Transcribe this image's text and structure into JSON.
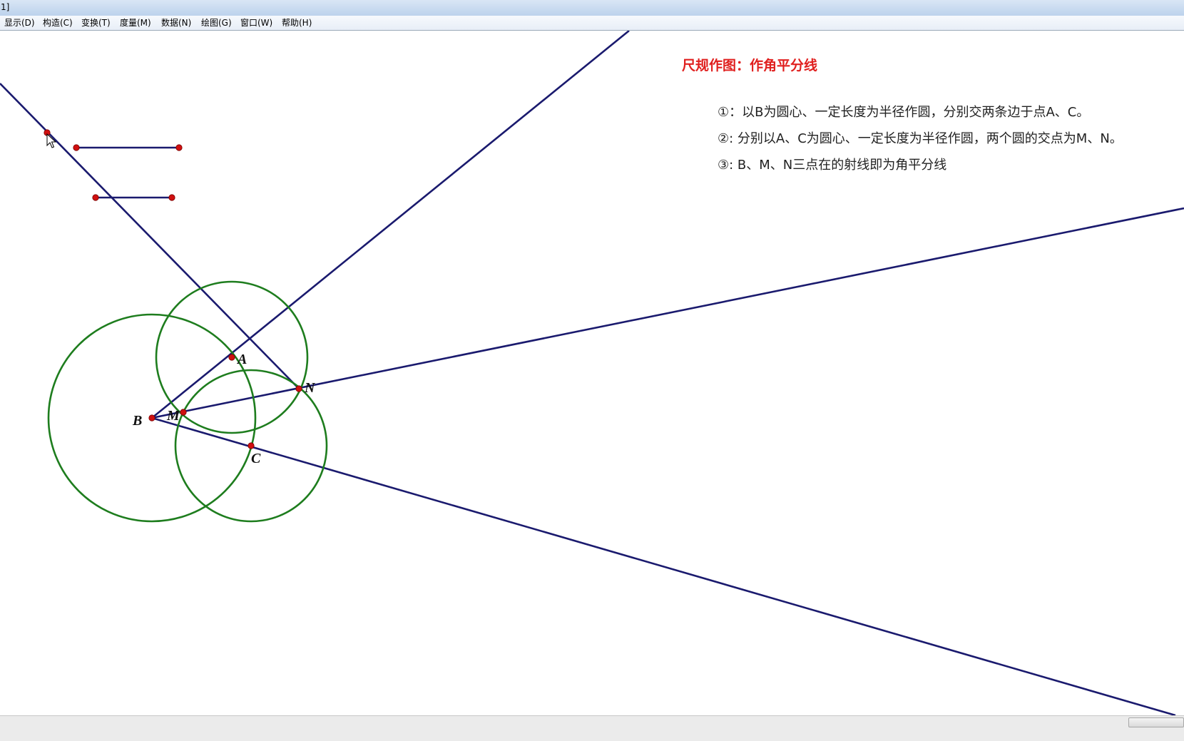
{
  "window": {
    "title": "1]"
  },
  "menubar": {
    "items": [
      {
        "label": "显示(D)"
      },
      {
        "label": "构造(C)"
      },
      {
        "label": "变换(T)"
      },
      {
        "label": "度量(M)"
      },
      {
        "label": "数据(N)"
      },
      {
        "label": "绘图(G)"
      },
      {
        "label": "窗口(W)"
      },
      {
        "label": "帮助(H)"
      }
    ]
  },
  "content": {
    "heading": "尺规作图：作角平分线",
    "steps": [
      "①：以B为圆心、一定长度为半径作圆，分别交两条边于点A、C。",
      "②:  分别以A、C为圆心、一定长度为半径作圆，两个圆的交点为M、N。",
      "③:  B、M、N三点在的射线即为角平分线"
    ]
  },
  "points": {
    "labels": {
      "A": "A",
      "B": "B",
      "C": "C",
      "M": "M",
      "N": "N"
    }
  },
  "colors": {
    "line": "#1a1a6e",
    "circle": "#1e7d1e",
    "point": "#d01010",
    "heading": "#e0201f"
  },
  "icons": {
    "cursor": "mouse-pointer-icon"
  }
}
